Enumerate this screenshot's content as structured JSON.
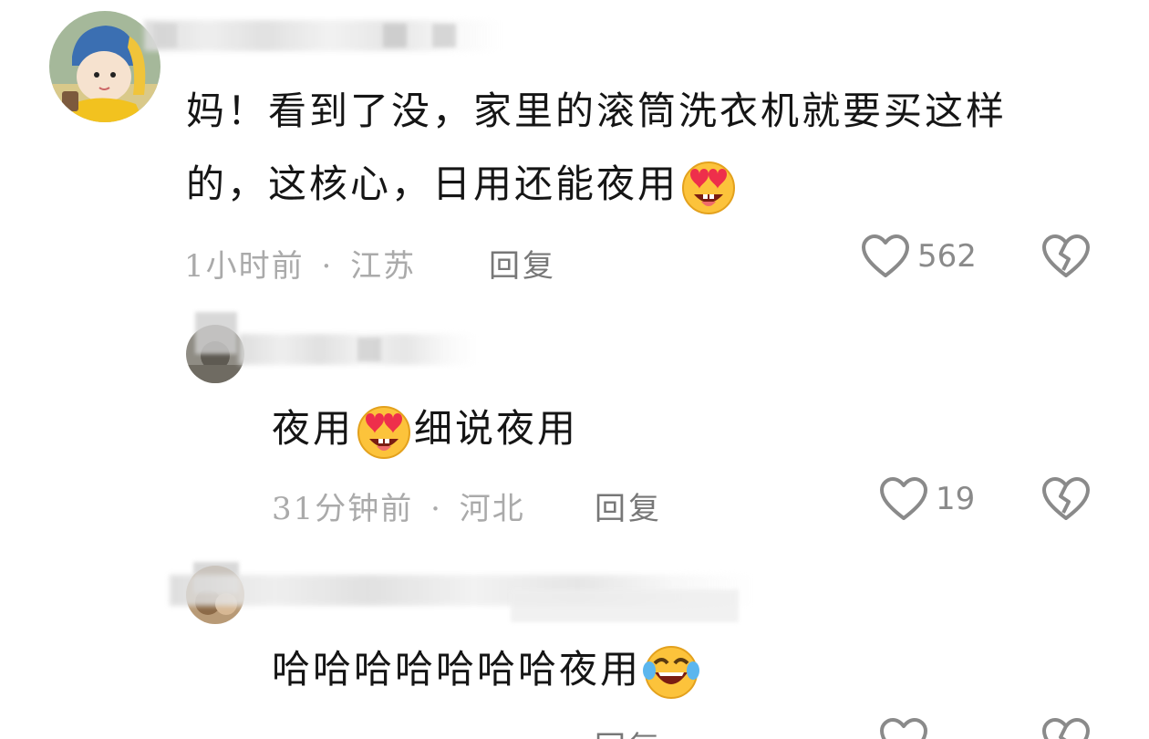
{
  "comments": [
    {
      "text_line1": "妈！看到了没，家里的滚筒洗衣机就要买这样",
      "text_line2": "的，这核心，日用还能夜用",
      "emoji": "heart-eyes-emoji",
      "time": "1小时前",
      "location": "江苏",
      "separator": "·",
      "reply_label": "回复",
      "likes": "562"
    },
    {
      "text_before": "夜用",
      "text_after": "细说夜用",
      "emoji": "heart-eyes-emoji",
      "time": "31分钟前",
      "location": "河北",
      "separator": "·",
      "reply_label": "回复",
      "likes": "19"
    },
    {
      "text": "哈哈哈哈哈哈哈夜用",
      "emoji": "laughing-tears-emoji",
      "time": "",
      "location": "",
      "reply_label": "回复",
      "likes": ""
    }
  ],
  "colors": {
    "text": "#151515",
    "meta": "#aaaaaa",
    "icon": "#8a8a8a",
    "background": "#ffffff"
  }
}
